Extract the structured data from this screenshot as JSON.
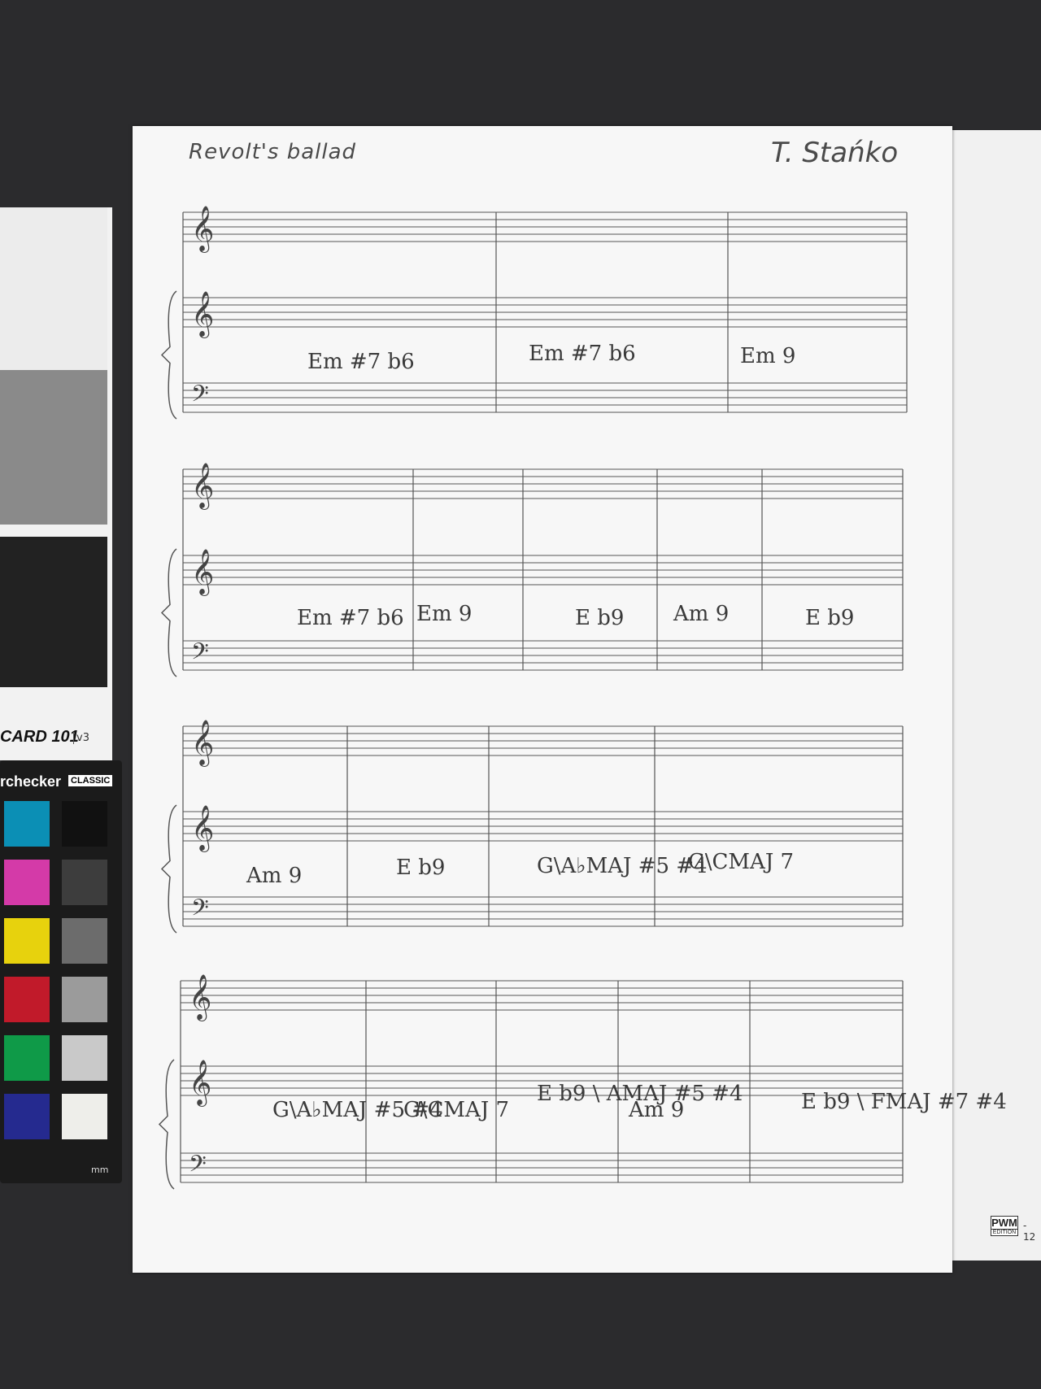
{
  "manuscript": {
    "title": "Revolt's ballad",
    "composer_signature": "T. Stańko",
    "systems": [
      {
        "chords": [
          "Em #7 b6",
          "Em #7 b6",
          "Em 9"
        ]
      },
      {
        "chords": [
          "Em #7 b6",
          "Em 9",
          "E b9",
          "Am 9",
          "E b9"
        ]
      },
      {
        "chords": [
          "Am 9",
          "E b9",
          "G\\A♭MAJ #5 #4",
          "G\\CMAJ 7"
        ]
      },
      {
        "chords": [
          "G\\A♭MAJ #5 #4",
          "G\\CMAJ 7",
          "E b9 \\ AMAJ #5 #4",
          "Am 9",
          "E b9 \\ FMAJ #7 #4"
        ]
      }
    ]
  },
  "calibration_target": {
    "label": "CARD 101",
    "version": "v3",
    "checker_brand": "rchecker",
    "checker_badge": "CLASSIC",
    "unit": "mm",
    "swatches_left": [
      "#0b8fb5",
      "#d43aa8",
      "#e7d20d",
      "#c11a2a",
      "#0f9a48",
      "#252a8f"
    ],
    "swatches_right": [
      "#111111",
      "#3d3d3d",
      "#6c6c6c",
      "#9b9b9b",
      "#c9c9c9",
      "#eeeeea"
    ]
  },
  "publisher_mark": {
    "text": "PWM",
    "sub": "EDITION",
    "page_fragment": "- 12"
  }
}
